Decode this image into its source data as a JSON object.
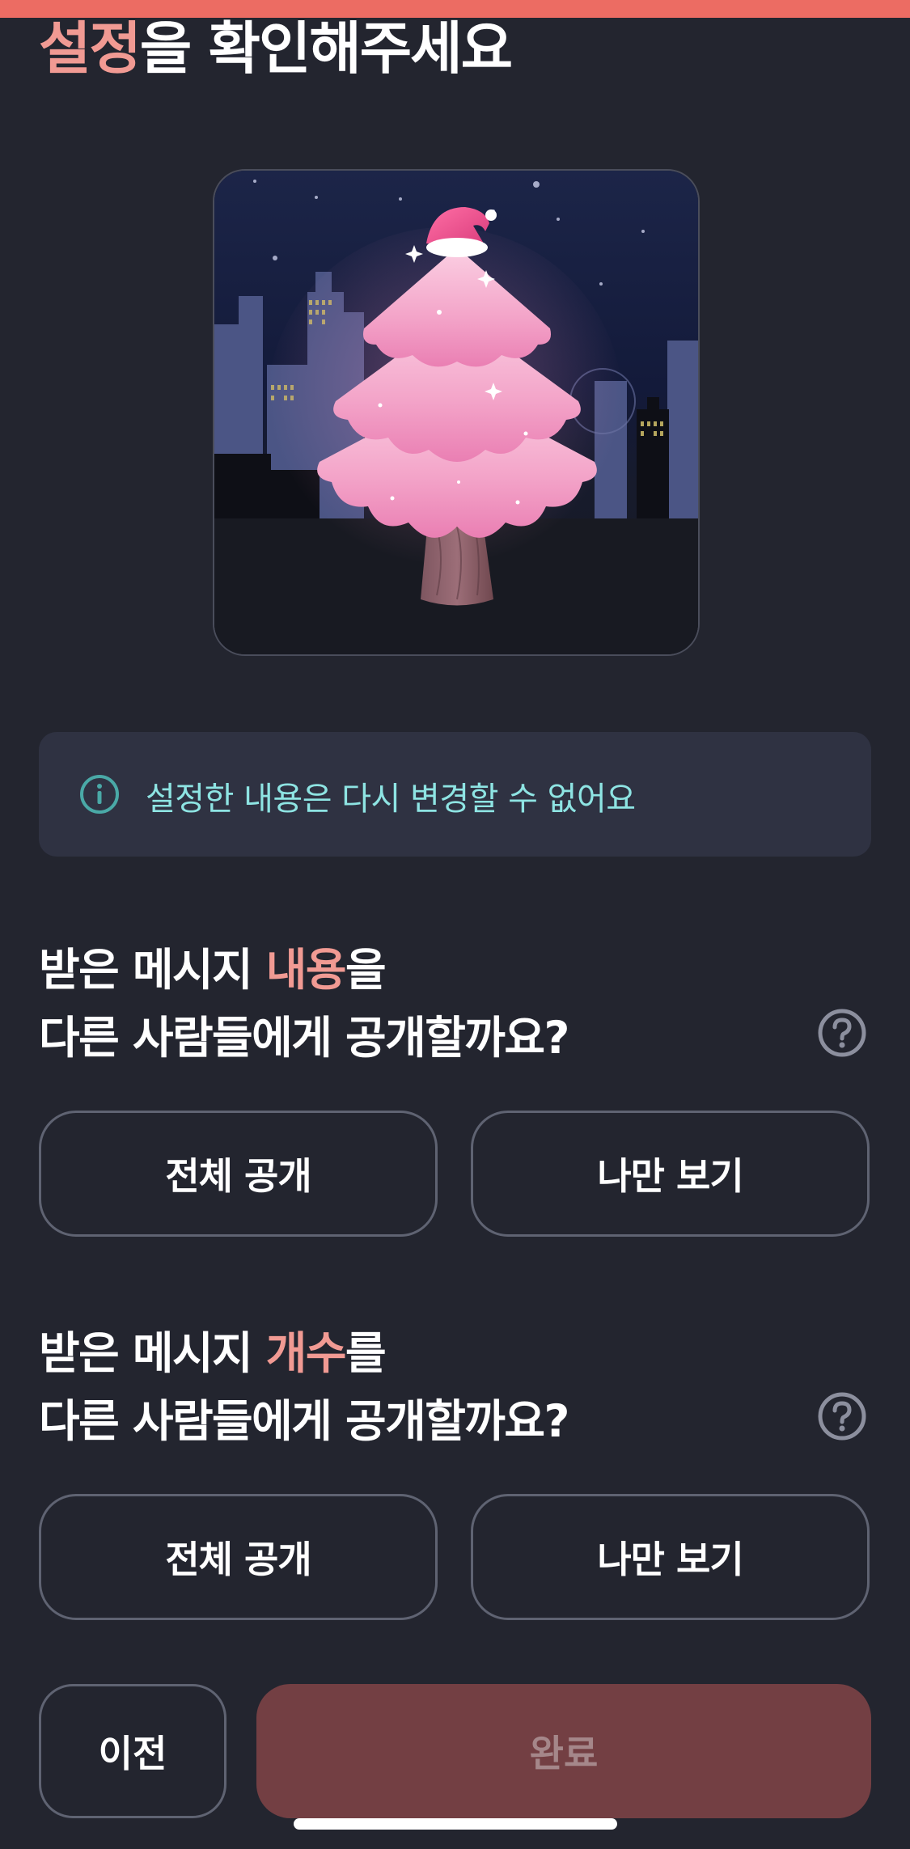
{
  "header": {
    "title_accent": "설정",
    "title_rest": "을 확인해주세요"
  },
  "notice": {
    "icon": "info-icon",
    "text": "설정한 내용은 다시 변경할 수 없어요"
  },
  "question_content": {
    "line1_before": "받은 메시지 ",
    "line1_accent": "내용",
    "line1_after": "을",
    "line2": "다른 사람들에게 공개할까요?",
    "help_icon": "help-circle-icon",
    "option_public": "전체 공개",
    "option_private": "나만 보기"
  },
  "question_count": {
    "line1_before": "받은 메시지 ",
    "line1_accent": "개수",
    "line1_after": "를",
    "line2": "다른 사람들에게 공개할까요?",
    "help_icon": "help-circle-icon",
    "option_public": "전체 공개",
    "option_private": "나만 보기"
  },
  "footer": {
    "prev_label": "이전",
    "done_label": "완료"
  },
  "colors": {
    "background": "#23252f",
    "accent": "#f19a93",
    "progress_bar": "#ec6c63",
    "notice_text": "#8ee4e3",
    "done_button_disabled": "#733f43"
  }
}
